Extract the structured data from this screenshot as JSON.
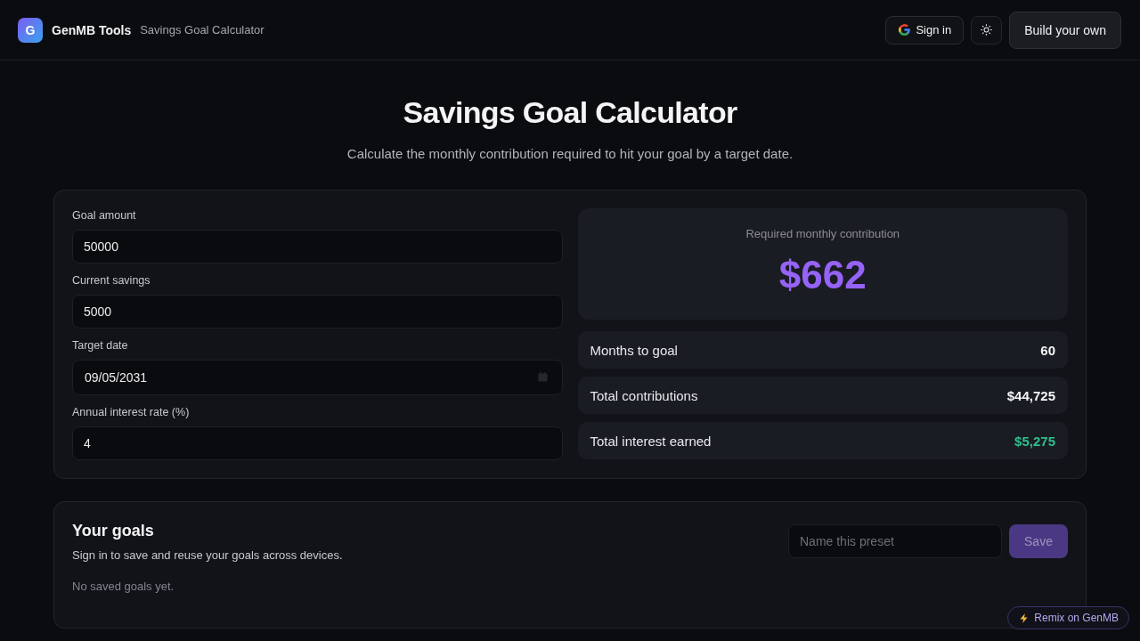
{
  "header": {
    "logo_letter": "G",
    "brand": "GenMB Tools",
    "page_name": "Savings Goal Calculator",
    "sign_in": "Sign in",
    "build_button": "Build your own"
  },
  "hero": {
    "title": "Savings Goal Calculator",
    "subtitle": "Calculate the monthly contribution required to hit your goal by a target date."
  },
  "calculator": {
    "fields": [
      {
        "label": "Goal amount",
        "value": "50000",
        "kind": "number"
      },
      {
        "label": "Current savings",
        "value": "5000",
        "kind": "number"
      },
      {
        "label": "Target date",
        "value": "09/05/2031",
        "kind": "date"
      },
      {
        "label": "Annual interest rate (%)",
        "value": "4",
        "kind": "number"
      }
    ],
    "result": {
      "label": "Required monthly contribution",
      "value": "$662"
    },
    "stats": [
      {
        "label": "Months to goal",
        "value": "60",
        "color": "#f4f4f6"
      },
      {
        "label": "Total contributions",
        "value": "$44,725",
        "color": "#f4f4f6"
      },
      {
        "label": "Total interest earned",
        "value": "$5,275",
        "color": "#2fbf8c"
      }
    ]
  },
  "goals": {
    "title": "Your goals",
    "subtitle": "Sign in to save and reuse your goals across devices.",
    "empty_text": "No saved goals yet.",
    "preset_placeholder": "Name this preset",
    "save_button": {
      "label": "Save",
      "disabled": true
    }
  },
  "remix": {
    "label": "Remix on GenMB"
  }
}
